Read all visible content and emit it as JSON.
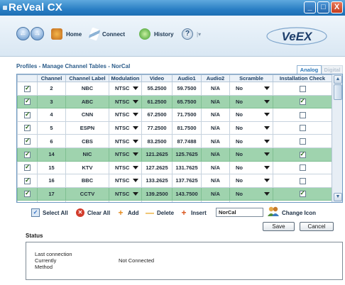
{
  "window": {
    "title": "ReVeal CX",
    "minimize": "_",
    "maximize": "□",
    "close": "X"
  },
  "toolbar": {
    "back": "←",
    "forward": "→",
    "home_label": "Home",
    "connect_label": "Connect",
    "history_label": "History",
    "help_label": "?",
    "help_menu": "|▾",
    "logo_text": "VeEX"
  },
  "panel": {
    "title": "Profiles - Manage Channel Tables - NorCal",
    "tabs": [
      "Analog",
      "Digital"
    ]
  },
  "table": {
    "headers": [
      "",
      "Channel",
      "Channel Label",
      "Modulation",
      "Video",
      "Audio1",
      "Audio2",
      "Scramble",
      "Installation Check"
    ],
    "rows": [
      {
        "checked": true,
        "channel": "2",
        "label": "NBC",
        "modulation": "NTSC",
        "video": "55.2500",
        "audio1": "59.7500",
        "audio2": "N/A",
        "scramble": "No",
        "install": false,
        "highlight": false
      },
      {
        "checked": true,
        "channel": "3",
        "label": "ABC",
        "modulation": "NTSC",
        "video": "61.2500",
        "audio1": "65.7500",
        "audio2": "N/A",
        "scramble": "No",
        "install": true,
        "highlight": true
      },
      {
        "checked": true,
        "channel": "4",
        "label": "CNN",
        "modulation": "NTSC",
        "video": "67.2500",
        "audio1": "71.7500",
        "audio2": "N/A",
        "scramble": "No",
        "install": false,
        "highlight": false
      },
      {
        "checked": true,
        "channel": "5",
        "label": "ESPN",
        "modulation": "NTSC",
        "video": "77.2500",
        "audio1": "81.7500",
        "audio2": "N/A",
        "scramble": "No",
        "install": false,
        "highlight": false
      },
      {
        "checked": true,
        "channel": "6",
        "label": "CBS",
        "modulation": "NTSC",
        "video": "83.2500",
        "audio1": "87.7488",
        "audio2": "N/A",
        "scramble": "No",
        "install": false,
        "highlight": false
      },
      {
        "checked": true,
        "channel": "14",
        "label": "NIC",
        "modulation": "NTSC",
        "video": "121.2625",
        "audio1": "125.7625",
        "audio2": "N/A",
        "scramble": "No",
        "install": true,
        "highlight": true
      },
      {
        "checked": true,
        "channel": "15",
        "label": "KTV",
        "modulation": "NTSC",
        "video": "127.2625",
        "audio1": "131.7625",
        "audio2": "N/A",
        "scramble": "No",
        "install": false,
        "highlight": false
      },
      {
        "checked": true,
        "channel": "16",
        "label": "BBC",
        "modulation": "NTSC",
        "video": "133.2625",
        "audio1": "137.7625",
        "audio2": "N/A",
        "scramble": "No",
        "install": false,
        "highlight": false
      },
      {
        "checked": true,
        "channel": "17",
        "label": "CCTV",
        "modulation": "NTSC",
        "video": "139.2500",
        "audio1": "143.7500",
        "audio2": "N/A",
        "scramble": "No",
        "install": true,
        "highlight": true
      },
      {
        "checked": true,
        "channel": "18",
        "label": "SFTV",
        "modulation": "NTSC",
        "video": "145.2500",
        "audio1": "149.7500",
        "audio2": "N/A",
        "scramble": "No",
        "install": false,
        "highlight": false
      },
      {
        "checked": true,
        "channel": "19",
        "label": "KQED",
        "modulation": "NTSC",
        "video": "151.2500",
        "audio1": "155.7500",
        "audio2": "N/A",
        "scramble": "No",
        "install": false,
        "highlight": false
      }
    ]
  },
  "actions": {
    "select_all": "Select All",
    "clear_all": "Clear All",
    "add": "Add",
    "delete": "Delete",
    "insert": "Insert",
    "name_value": "NorCal",
    "change_icon": "Change Icon",
    "save": "Save",
    "cancel": "Cancel"
  },
  "status": {
    "title": "Status",
    "lines": [
      {
        "label": "Last connection",
        "value": ""
      },
      {
        "label": "Currently",
        "value": "Not Connected"
      },
      {
        "label": "Method",
        "value": ""
      }
    ]
  },
  "colors": {
    "titlebar": "#2a7fc4",
    "highlight_row": "#9fd3ae",
    "panel_title": "#2b5c8a"
  }
}
